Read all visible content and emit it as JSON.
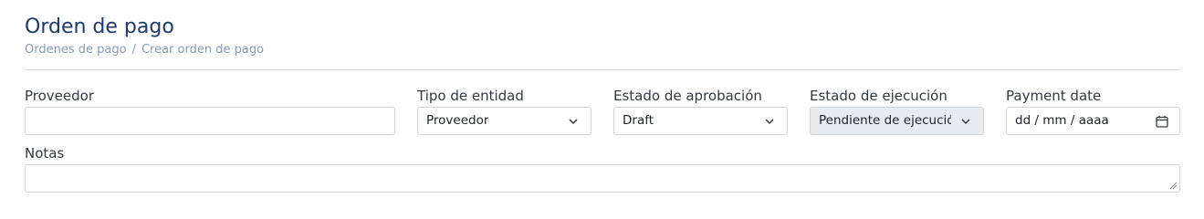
{
  "header": {
    "title": "Orden de pago",
    "breadcrumb": {
      "items": [
        "Ordenes de pago",
        "Crear orden de pago"
      ],
      "separator": "/"
    }
  },
  "form": {
    "proveedor": {
      "label": "Proveedor",
      "value": ""
    },
    "tipo_entidad": {
      "label": "Tipo de entidad",
      "selected": "Proveedor"
    },
    "estado_aprobacion": {
      "label": "Estado de aprobación",
      "selected": "Draft"
    },
    "estado_ejecucion": {
      "label": "Estado de ejecución",
      "selected": "Pendiente de ejecución",
      "disabled": true
    },
    "payment_date": {
      "label": "Payment date",
      "placeholder": "dd / mm / aaaa"
    },
    "notas": {
      "label": "Notas",
      "value": ""
    }
  },
  "icons": {
    "select_arrow": "chevron-down-icon",
    "date_picker": "calendar-icon",
    "resize": "resize-grip-icon"
  },
  "colors": {
    "title": "#1c3a6b",
    "breadcrumb": "#8a9bb5",
    "border": "#ced4da",
    "disabled_bg": "#e9ecef"
  }
}
